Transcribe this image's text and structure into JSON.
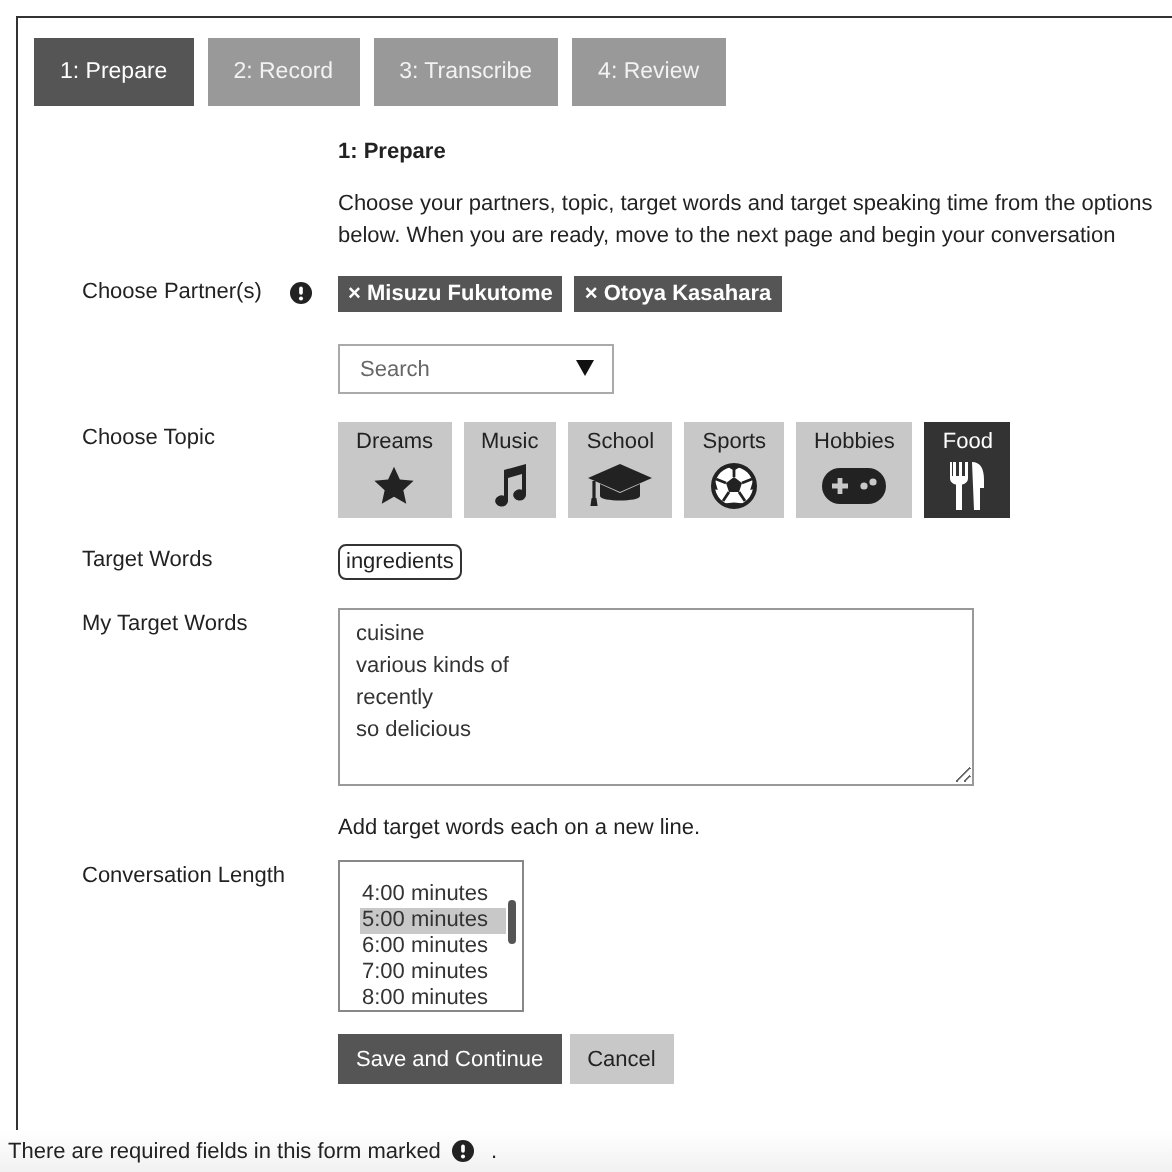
{
  "tabs": [
    {
      "label": "1: Prepare",
      "selected": true
    },
    {
      "label": "2: Record",
      "selected": false
    },
    {
      "label": "3: Transcribe",
      "selected": false
    },
    {
      "label": "4: Review",
      "selected": false
    }
  ],
  "heading": "1: Prepare",
  "intro": "Choose your partners, topic, target words and target speaking time from the options below. When you are ready, move to the next page and begin your conversation",
  "partners": {
    "label": "Choose Partner(s)",
    "required": true,
    "chips": [
      "× Misuzu Fukutome",
      "× Otoya Kasahara"
    ],
    "search": {
      "placeholder": "Search"
    }
  },
  "topics": {
    "label": "Choose Topic",
    "items": [
      {
        "label": "Dreams",
        "selected": false
      },
      {
        "label": "Music",
        "selected": false
      },
      {
        "label": "School",
        "selected": false
      },
      {
        "label": "Sports",
        "selected": false
      },
      {
        "label": "Hobbies",
        "selected": false
      },
      {
        "label": "Food",
        "selected": true
      }
    ]
  },
  "target_words": {
    "label": "Target Words",
    "words": [
      "ingredients"
    ]
  },
  "my_target_words": {
    "label": "My Target Words",
    "value": "cuisine\nvarious kinds of\nrecently\nso delicious",
    "hint": "Add target words each on a new line."
  },
  "conversation_length": {
    "label": "Conversation Length",
    "options": [
      {
        "label": "4:00 minutes",
        "selected": false
      },
      {
        "label": "5:00 minutes",
        "selected": true
      },
      {
        "label": "6:00 minutes",
        "selected": false
      },
      {
        "label": "7:00 minutes",
        "selected": false
      },
      {
        "label": "8:00 minutes",
        "selected": false
      }
    ]
  },
  "buttons": [
    {
      "label": "Save and Continue",
      "kind": "primary"
    },
    {
      "label": "Cancel",
      "kind": "secondary"
    }
  ],
  "footer": {
    "text": "There are required fields in this form marked",
    "end": "."
  }
}
